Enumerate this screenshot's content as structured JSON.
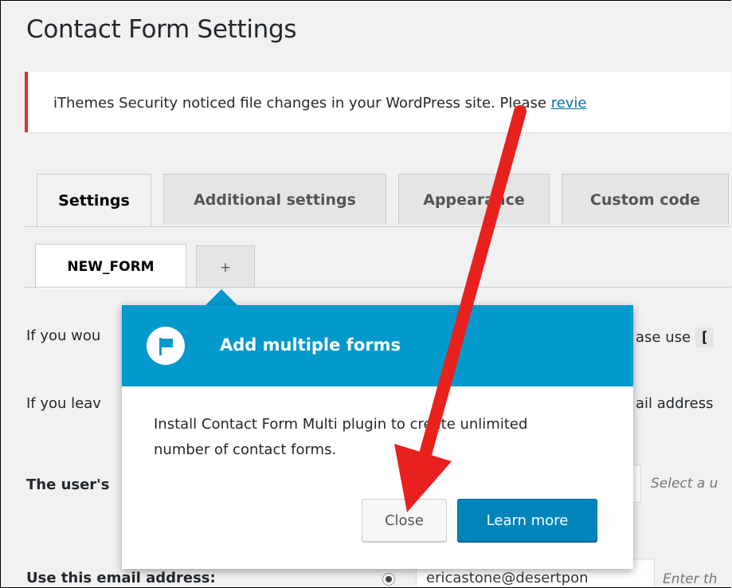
{
  "page": {
    "title": "Contact Form Settings"
  },
  "notice": {
    "text": "iThemes Security noticed file changes in your WordPress site. Please ",
    "link": "revie"
  },
  "tabs": [
    {
      "label": "Settings",
      "active": true
    },
    {
      "label": "Additional settings",
      "active": false
    },
    {
      "label": "Appearance",
      "active": false
    },
    {
      "label": "Custom code",
      "active": false
    }
  ],
  "subtabs": {
    "form": "NEW_FORM",
    "add": "+"
  },
  "content": {
    "line1_start": "If you wou",
    "line1_end": "ase use",
    "line1_chip": "[",
    "line2_start": "If you leav",
    "line2_end": "ail address",
    "user_label": "The user's",
    "user_hint": "Select a u",
    "email_label": "Use this email address:",
    "email_value": "ericastone@desertpon",
    "email_hint": "Enter th"
  },
  "pointer": {
    "title": "Add multiple forms",
    "body": "Install Contact Form Multi plugin to create unlimited number of contact forms.",
    "close_label": "Close",
    "learn_label": "Learn more",
    "header_color": "#0499cc",
    "icon": "flag-icon"
  },
  "annotation": {
    "arrow_color": "#e8211f"
  }
}
